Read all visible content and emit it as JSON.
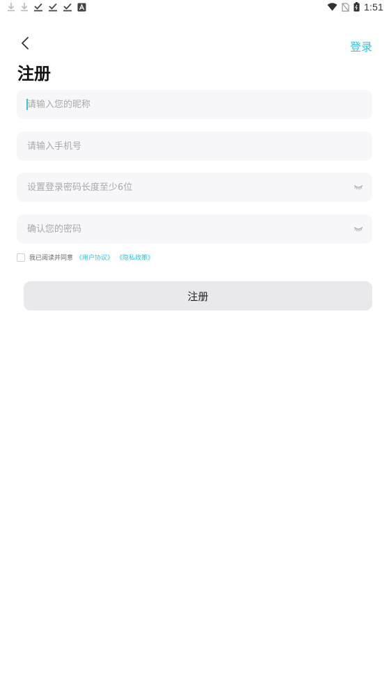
{
  "status_bar": {
    "time": "1:51",
    "left_icons": [
      "download-icon",
      "download-icon",
      "check-icon",
      "check-icon",
      "check-icon",
      "a-box-icon"
    ],
    "right_icons": [
      "wifi-icon",
      "no-sim-icon",
      "battery-icon"
    ]
  },
  "header": {
    "back_icon": "chevron-left-icon",
    "login_label": "登录",
    "title": "注册"
  },
  "form": {
    "nickname": {
      "placeholder": "请输入您的昵称",
      "value": ""
    },
    "phone": {
      "placeholder": "请输入手机号",
      "value": ""
    },
    "password": {
      "placeholder": "设置登录密码长度至少6位",
      "value": ""
    },
    "confirm_password": {
      "placeholder": "确认您的密码",
      "value": ""
    },
    "eye_icon": "eye-closed-icon"
  },
  "agreement": {
    "prefix": "我已阅读并同意",
    "user_agreement": "《用户协议》",
    "privacy_policy": "《隐私政策》",
    "checked": false
  },
  "submit": {
    "label": "注册"
  },
  "colors": {
    "accent": "#31c3e0",
    "field_bg": "#f7f6f8",
    "button_bg": "#e9e9eb"
  }
}
